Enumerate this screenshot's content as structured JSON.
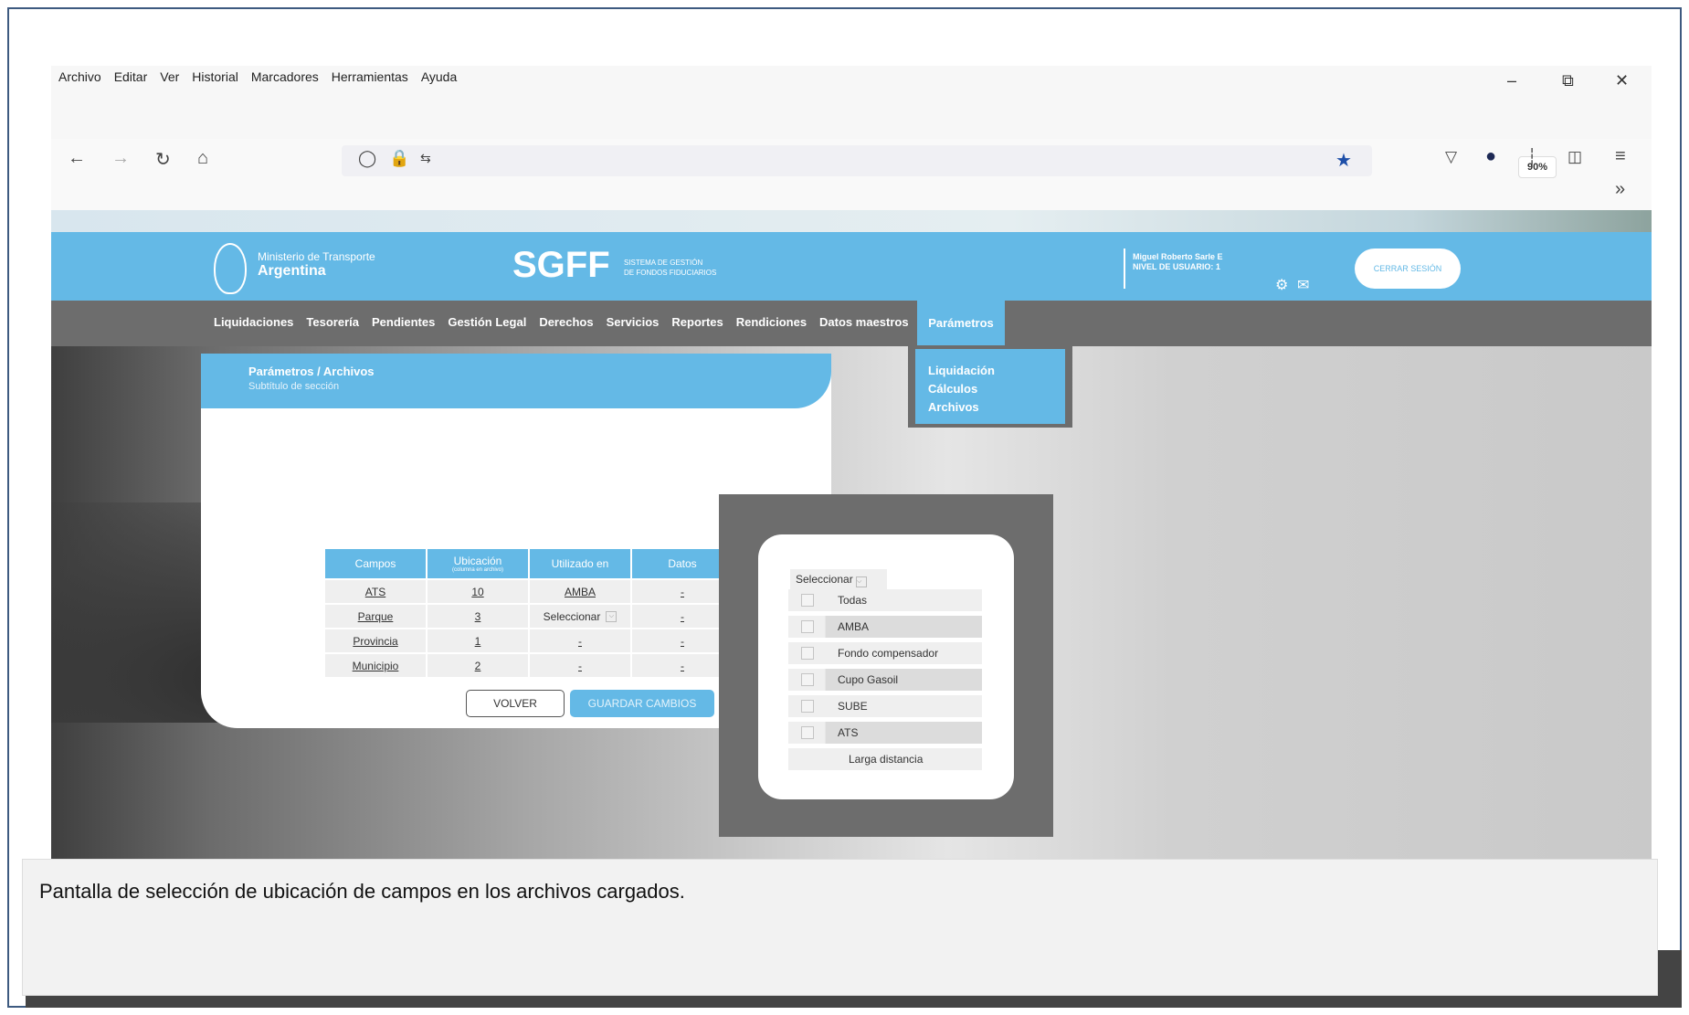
{
  "browser": {
    "menu": [
      "Archivo",
      "Editar",
      "Ver",
      "Historial",
      "Marcadores",
      "Herramientas",
      "Ayuda"
    ],
    "zoom": "90%",
    "window_controls": [
      "minimize-icon",
      "restore-icon",
      "close-icon"
    ],
    "nav_icons": [
      "back-icon",
      "forward-icon",
      "reload-icon",
      "home-icon",
      "shield-icon",
      "lock-icon",
      "permissions-icon",
      "star-icon",
      "pocket-icon",
      "account-icon",
      "library-icon",
      "sidebar-icon",
      "hamburger-menu-icon",
      "overflow-icon"
    ]
  },
  "header": {
    "ministry_line1": "Ministerio de Transporte",
    "ministry_line2": "Argentina",
    "app": "SGFF",
    "app_sub_line1": "SISTEMA DE GESTIÓN",
    "app_sub_line2": "DE FONDOS FIDUCIARIOS",
    "user_name": "Miguel Roberto Sarle E",
    "user_level": "NIVEL DE USUARIO: 1",
    "logout": "CERRAR SESIÓN",
    "colors": {
      "primary": "#64b9e6",
      "nav": "#6d6d6d"
    }
  },
  "nav": {
    "items": [
      "Liquidaciones",
      "Tesorería",
      "Pendientes",
      "Gestión Legal",
      "Derechos",
      "Servicios",
      "Reportes",
      "Rendiciones",
      "Datos maestros"
    ],
    "active": "Parámetros",
    "submenu": [
      "Liquidación",
      "Cálculos",
      "Archivos"
    ]
  },
  "section": {
    "breadcrumb": "Parámetros / Archivos",
    "subtitle": "Subtítulo de sección"
  },
  "table": {
    "headers": [
      "Campos",
      "Ubicación",
      "Utilizado en",
      "Datos"
    ],
    "header_sub": "(columna en archivo)",
    "rows": [
      {
        "campo": "ATS",
        "ubicacion": "10",
        "utilizado": "AMBA",
        "datos": "-"
      },
      {
        "campo": "Parque",
        "ubicacion": "3",
        "utilizado": "Seleccionar",
        "datos": "-"
      },
      {
        "campo": "Provincia",
        "ubicacion": "1",
        "utilizado": "-",
        "datos": "-"
      },
      {
        "campo": "Municipio",
        "ubicacion": "2",
        "utilizado": "-",
        "datos": "-"
      }
    ]
  },
  "buttons": {
    "back": "VOLVER",
    "save": "GUARDAR CAMBIOS"
  },
  "popup": {
    "select": "Seleccionar",
    "options": [
      "Todas",
      "AMBA",
      "Fondo compensador",
      "Cupo Gasoil",
      "SUBE",
      "ATS",
      "Larga distancia"
    ]
  },
  "caption": "Pantalla de selección de ubicación de campos en los archivos cargados."
}
